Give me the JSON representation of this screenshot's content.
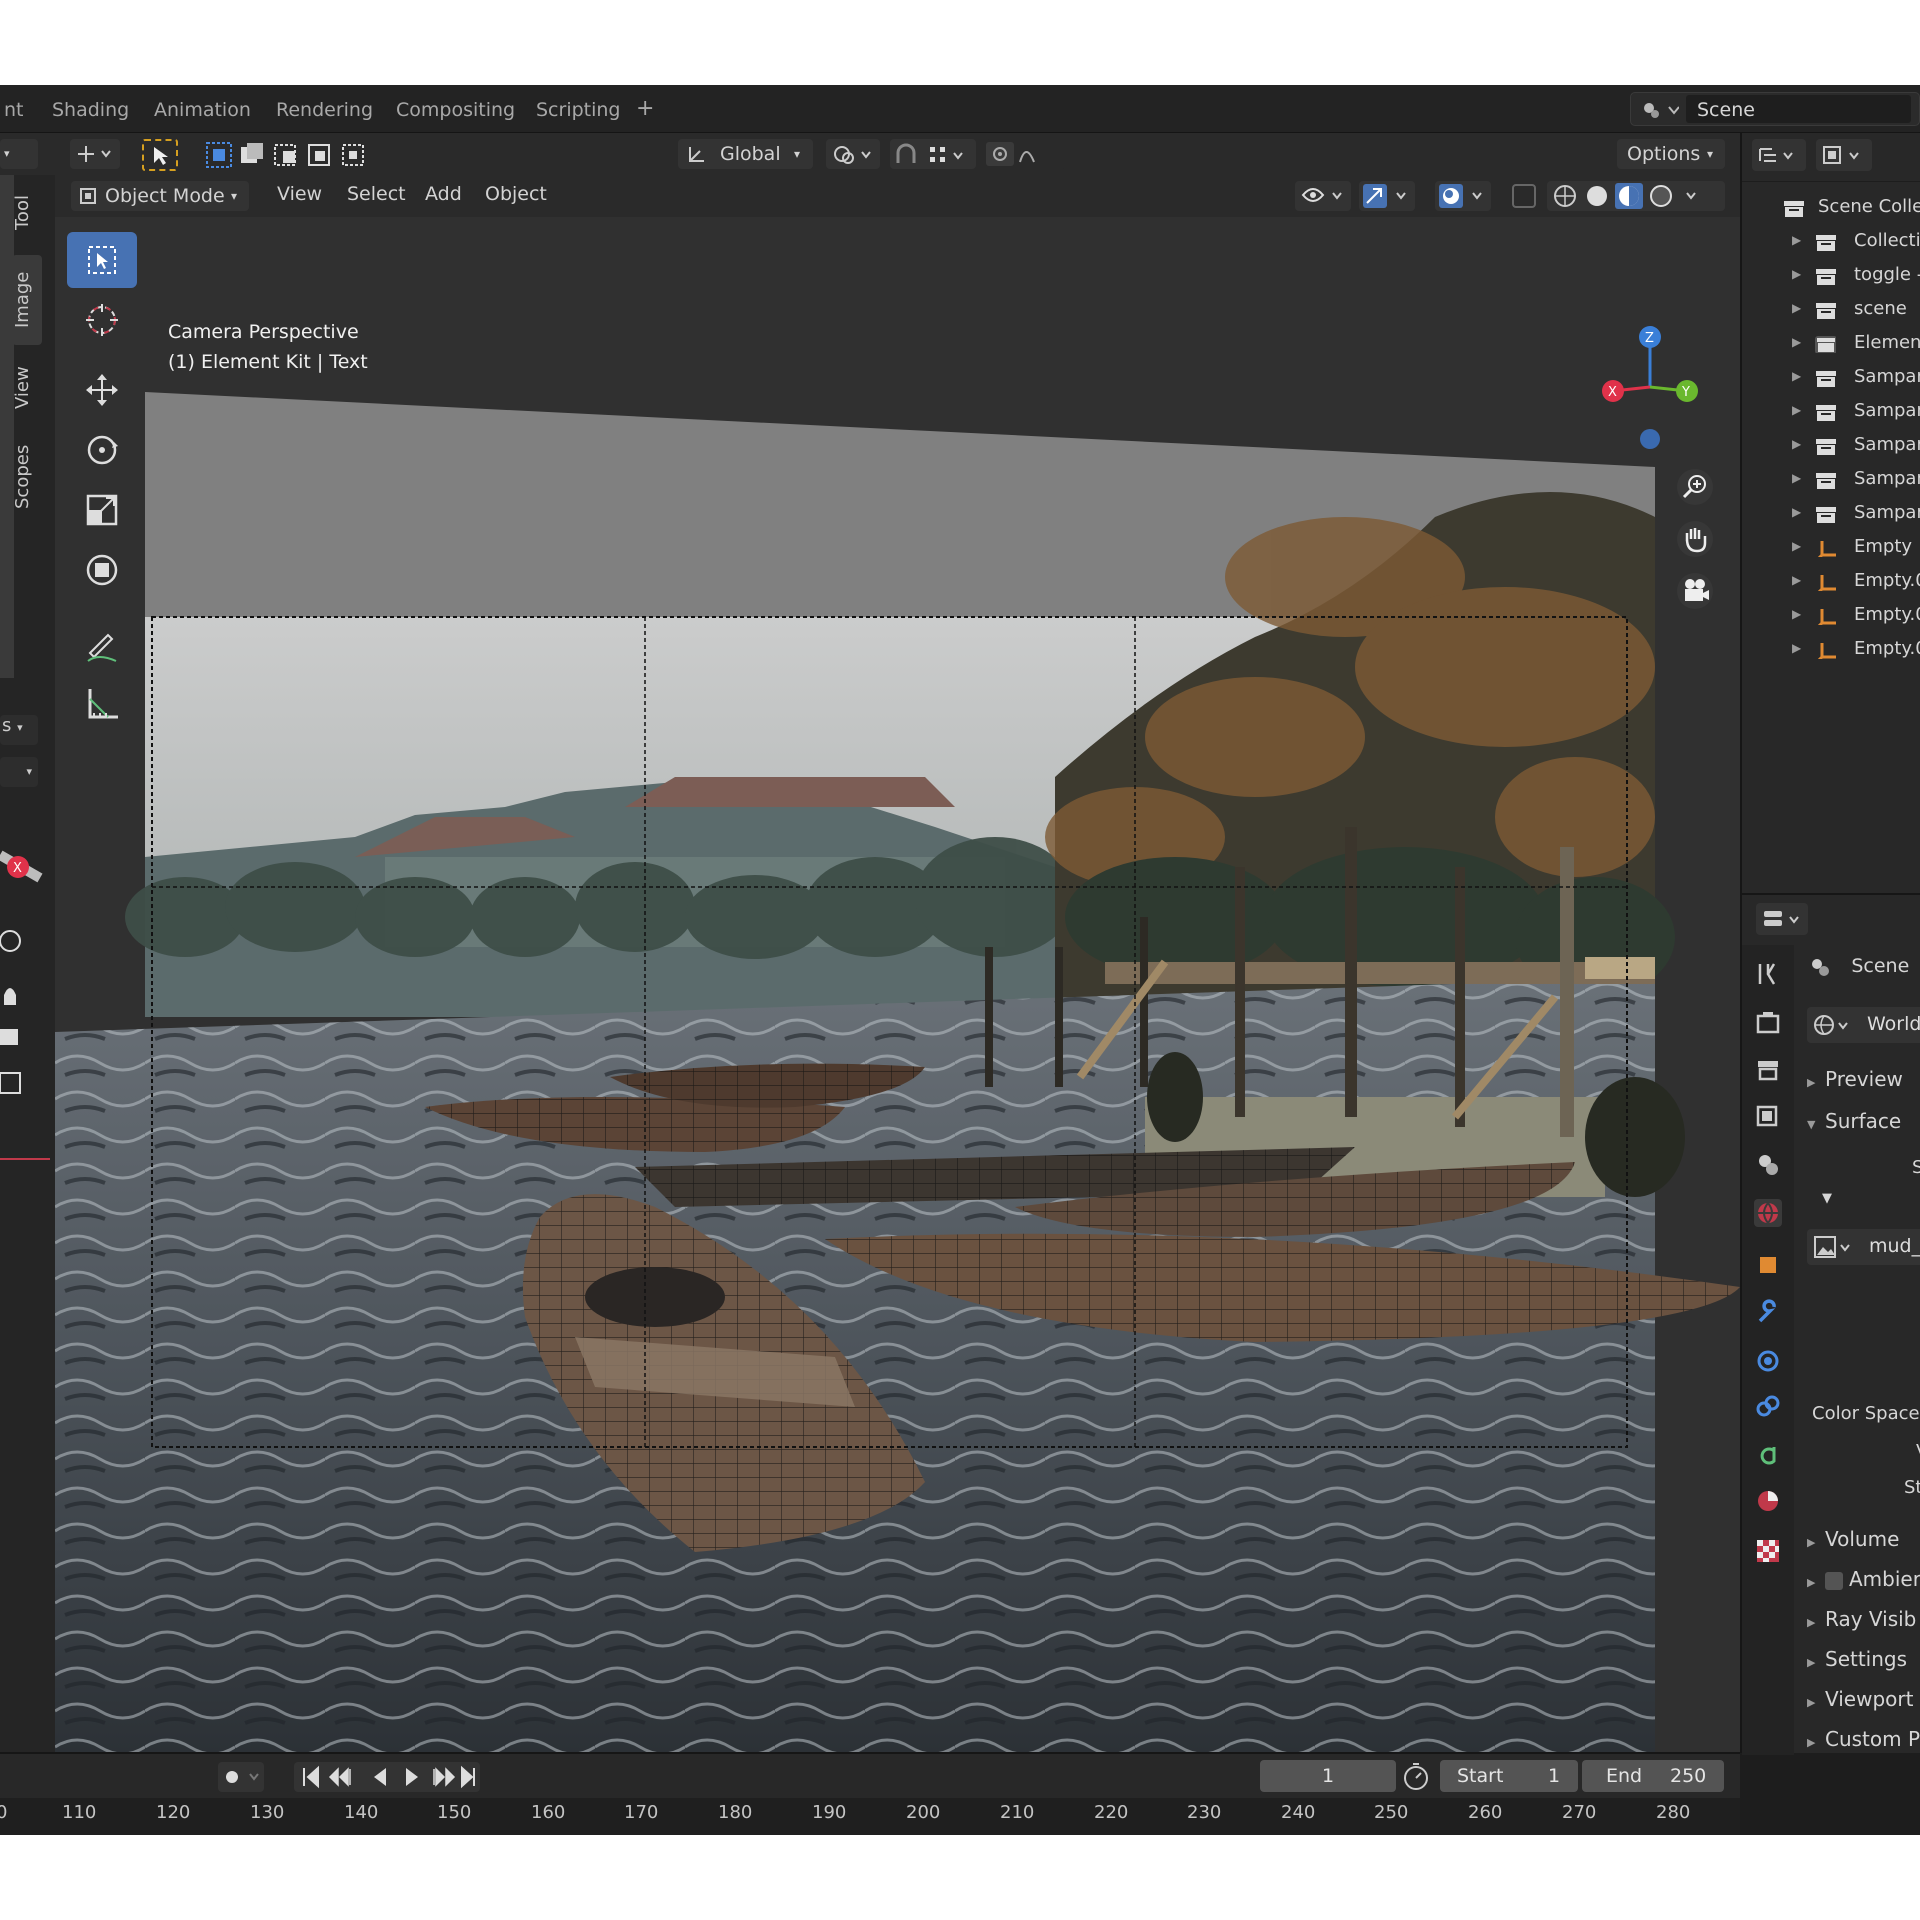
{
  "workspace_tabs": [
    "nt",
    "Shading",
    "Animation",
    "Rendering",
    "Compositing",
    "Scripting"
  ],
  "scene_name": "Scene",
  "tool_header": {
    "orientation": "Global",
    "options": "Options"
  },
  "viewport_header": {
    "mode": "Object Mode",
    "menus": [
      "View",
      "Select",
      "Add",
      "Object"
    ]
  },
  "viewport_overlay": {
    "line1": "Camera Perspective",
    "line2": "(1) Element Kit | Text"
  },
  "sidebar_tabs": [
    "Tool",
    "Image",
    "View",
    "Scopes"
  ],
  "left_panel": {
    "select_fragment": "s"
  },
  "gizmo": {
    "x": "X",
    "y": "Y",
    "z": "Z"
  },
  "outliner": [
    {
      "label": "Scene Colle",
      "type": "collection-root"
    },
    {
      "label": "Collecti",
      "type": "collection"
    },
    {
      "label": "toggle -",
      "type": "collection"
    },
    {
      "label": "scene",
      "type": "collection"
    },
    {
      "label": "Element",
      "type": "collection"
    },
    {
      "label": "Sampan",
      "type": "collection"
    },
    {
      "label": "Sampan",
      "type": "collection"
    },
    {
      "label": "Sampan",
      "type": "collection"
    },
    {
      "label": "Sampan",
      "type": "collection"
    },
    {
      "label": "Sampan",
      "type": "collection"
    },
    {
      "label": "Empty",
      "type": "empty"
    },
    {
      "label": "Empty.0",
      "type": "empty"
    },
    {
      "label": "Empty.0",
      "type": "empty"
    },
    {
      "label": "Empty.0",
      "type": "empty"
    }
  ],
  "properties": {
    "scene_label": "Scene",
    "world_label": "World",
    "sections": [
      "Preview",
      "Surface"
    ],
    "surface_value_fragment": "S",
    "image_name": "mud_",
    "color_space_label": "Color Space",
    "fragment_v": "V",
    "fragment_st": "St",
    "bottom_sections": [
      "Volume",
      "Ambier",
      "Ray Visib",
      "Settings",
      "Viewport",
      "Custom P"
    ]
  },
  "timeline": {
    "current_frame": "1",
    "start_label": "Start",
    "start_value": "1",
    "end_label": "End",
    "end_value": "250",
    "ticks": [
      "0",
      "110",
      "120",
      "130",
      "140",
      "150",
      "160",
      "170",
      "180",
      "190",
      "200",
      "210",
      "220",
      "230",
      "240",
      "250",
      "260",
      "270",
      "280"
    ]
  },
  "colors": {
    "accent_blue": "#4772b3",
    "axis_x": "#e0324a",
    "axis_y": "#6ab82e",
    "axis_z": "#3a7fd8",
    "empty_icon": "#e08a32"
  }
}
